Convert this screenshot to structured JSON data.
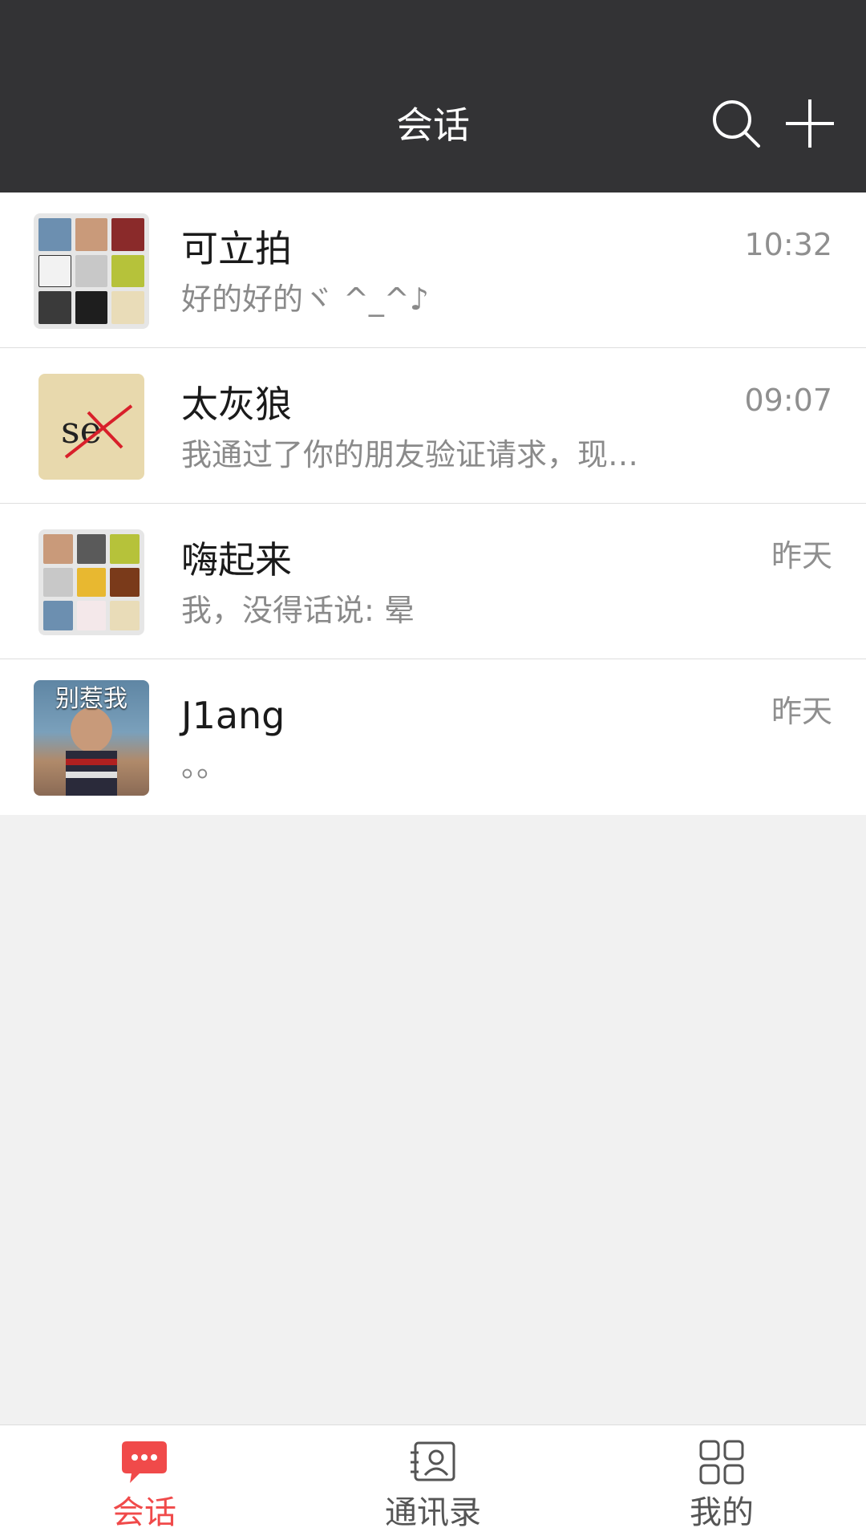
{
  "header": {
    "title": "会话",
    "search_icon": "search-icon",
    "add_icon": "plus-icon"
  },
  "conversations": [
    {
      "name": "可立拍",
      "time": "10:32",
      "preview": "好的好的ヾ ^_^♪",
      "avatar": "group-avatar"
    },
    {
      "name": "太灰狼",
      "time": "09:07",
      "preview": "我通过了你的朋友验证请求，现…",
      "avatar": "user-avatar"
    },
    {
      "name": "嗨起来",
      "time": "昨天",
      "preview": "我，没得话说: 晕",
      "avatar": "group-avatar"
    },
    {
      "name": "J1ang",
      "time": "昨天",
      "preview": "。。",
      "avatar": "user-avatar",
      "avatar_caption": "别惹我"
    }
  ],
  "tabbar": {
    "tabs": [
      {
        "label": "会话",
        "icon": "chat-bubble-icon",
        "active": true
      },
      {
        "label": "通讯录",
        "icon": "contacts-icon",
        "active": false
      },
      {
        "label": "我的",
        "icon": "grid-icon",
        "active": false
      }
    ]
  },
  "colors": {
    "header_bg": "#333335",
    "accent": "#f04a4a",
    "page_bg": "#f1f1f1"
  }
}
